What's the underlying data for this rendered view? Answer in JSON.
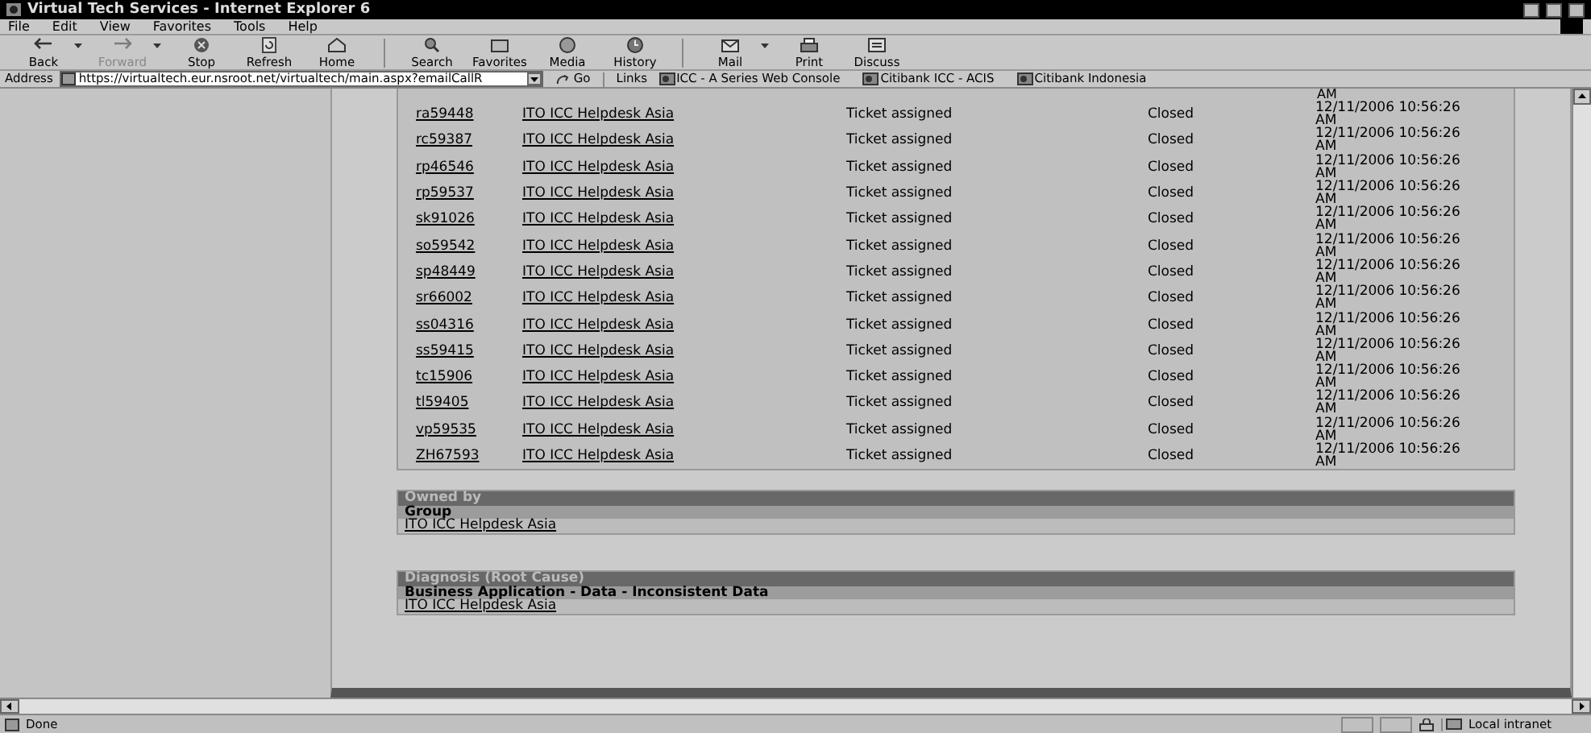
{
  "window": {
    "title": "Virtual Tech Services - Internet Explorer 6"
  },
  "menu": [
    "File",
    "Edit",
    "View",
    "Favorites",
    "Tools",
    "Help"
  ],
  "toolbar": [
    {
      "label": "Back",
      "kind": "arrow-left",
      "disabled": false,
      "dropdown": true
    },
    {
      "label": "Forward",
      "kind": "arrow-right",
      "disabled": true,
      "dropdown": true
    },
    {
      "label": "Stop",
      "kind": "stop",
      "disabled": false,
      "dropdown": false
    },
    {
      "label": "Refresh",
      "kind": "refresh",
      "disabled": false,
      "dropdown": false
    },
    {
      "label": "Home",
      "kind": "home",
      "disabled": false,
      "dropdown": false
    },
    {
      "kind": "separator"
    },
    {
      "label": "Search",
      "kind": "search",
      "disabled": false,
      "dropdown": false
    },
    {
      "label": "Favorites",
      "kind": "folder",
      "disabled": false,
      "dropdown": false
    },
    {
      "label": "Media",
      "kind": "globe",
      "disabled": false,
      "dropdown": false
    },
    {
      "label": "History",
      "kind": "history",
      "disabled": false,
      "dropdown": false
    },
    {
      "kind": "separator"
    },
    {
      "label": "Mail",
      "kind": "mail",
      "disabled": false,
      "dropdown": true
    },
    {
      "label": "Print",
      "kind": "print",
      "disabled": false,
      "dropdown": false
    },
    {
      "label": "Discuss",
      "kind": "discuss",
      "disabled": false,
      "dropdown": false
    }
  ],
  "address": {
    "label": "Address",
    "url": "https://virtualtech.eur.nsroot.net/virtualtech/main.aspx?emailCallR",
    "go": "Go"
  },
  "links": {
    "label": "Links",
    "items": [
      "ICC - A Series Web Console",
      "Citibank ICC - ACIS",
      "Citibank Indonesia"
    ]
  },
  "table": {
    "top_remnant": "AM",
    "rows": [
      {
        "id": "ra59448",
        "group": "ITO ICC Helpdesk Asia",
        "action": "Ticket assigned",
        "status": "Closed",
        "date": "12/11/2006 10:56:26 AM"
      },
      {
        "id": "rc59387",
        "group": "ITO ICC Helpdesk Asia",
        "action": "Ticket assigned",
        "status": "Closed",
        "date": "12/11/2006 10:56:26 AM"
      },
      {
        "id": "rp46546",
        "group": "ITO ICC Helpdesk Asia",
        "action": "Ticket assigned",
        "status": "Closed",
        "date": "12/11/2006 10:56:26 AM"
      },
      {
        "id": "rp59537",
        "group": "ITO ICC Helpdesk Asia",
        "action": "Ticket assigned",
        "status": "Closed",
        "date": "12/11/2006 10:56:26 AM"
      },
      {
        "id": "sk91026",
        "group": "ITO ICC Helpdesk Asia",
        "action": "Ticket assigned",
        "status": "Closed",
        "date": "12/11/2006 10:56:26 AM"
      },
      {
        "id": "so59542",
        "group": "ITO ICC Helpdesk Asia",
        "action": "Ticket assigned",
        "status": "Closed",
        "date": "12/11/2006 10:56:26 AM"
      },
      {
        "id": "sp48449",
        "group": "ITO ICC Helpdesk Asia",
        "action": "Ticket assigned",
        "status": "Closed",
        "date": "12/11/2006 10:56:26 AM"
      },
      {
        "id": "sr66002",
        "group": "ITO ICC Helpdesk Asia",
        "action": "Ticket assigned",
        "status": "Closed",
        "date": "12/11/2006 10:56:26 AM"
      },
      {
        "id": "ss04316",
        "group": "ITO ICC Helpdesk Asia",
        "action": "Ticket assigned",
        "status": "Closed",
        "date": "12/11/2006 10:56:26 AM"
      },
      {
        "id": "ss59415",
        "group": "ITO ICC Helpdesk Asia",
        "action": "Ticket assigned",
        "status": "Closed",
        "date": "12/11/2006 10:56:26 AM"
      },
      {
        "id": "tc15906",
        "group": "ITO ICC Helpdesk Asia",
        "action": "Ticket assigned",
        "status": "Closed",
        "date": "12/11/2006 10:56:26 AM"
      },
      {
        "id": "tl59405",
        "group": "ITO ICC Helpdesk Asia",
        "action": "Ticket assigned",
        "status": "Closed",
        "date": "12/11/2006 10:56:26 AM"
      },
      {
        "id": "vp59535",
        "group": "ITO ICC Helpdesk Asia",
        "action": "Ticket assigned",
        "status": "Closed",
        "date": "12/11/2006 10:56:26 AM"
      },
      {
        "id": "ZH67593",
        "group": "ITO ICC Helpdesk Asia",
        "action": "Ticket assigned",
        "status": "Closed",
        "date": "12/11/2006 10:56:26 AM"
      }
    ]
  },
  "sections": [
    {
      "title": "Owned by",
      "label": "Group",
      "value": "ITO ICC Helpdesk Asia"
    },
    {
      "title": "Diagnosis (Root Cause)",
      "label": "Business Application - Data - Inconsistent Data",
      "value": "ITO ICC Helpdesk Asia"
    }
  ],
  "status_bar": {
    "text": "Done",
    "zone": "Local intranet"
  }
}
